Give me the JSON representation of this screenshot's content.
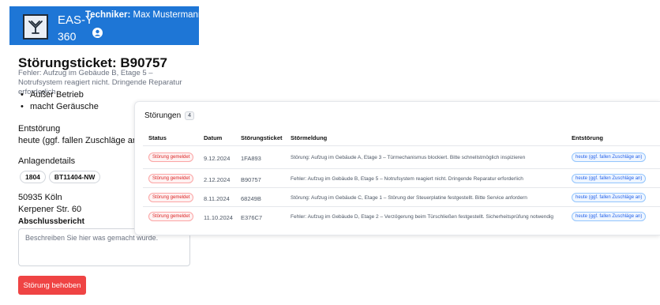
{
  "header": {
    "brand_line1": "EAS-Y",
    "brand_line2": "360",
    "technician_label": "Techniker:",
    "technician_name": "Max Mustermann",
    "logo_icon": "antenna-logo-icon",
    "user_icon": "user-circle-icon",
    "color": "#1e76d6"
  },
  "ticket": {
    "title": "Störungsticket: B90757",
    "description": "Fehler: Aufzug im Gebäude B, Etage 5 – Notrufsystem reagiert nicht. Dringende Reparatur erforderlich",
    "bullets": [
      "Außer Betrieb",
      "macht Geräusche"
    ],
    "entstoerung_label": "Entstörung",
    "entstoerung_value": "heute (ggf. fallen Zuschläge an)",
    "anlagendetails_label": "Anlagendetails",
    "chips": [
      "1804",
      "BT11404-NW"
    ],
    "city": "50935 Köln",
    "street": "Kerpener Str. 60",
    "abschluss_label": "Abschlussbericht",
    "textarea_placeholder": "Beschreiben Sie hier was gemacht wurde.",
    "fix_button": "Störung behoben",
    "fix_button_color": "#ef4444"
  },
  "stoerungen": {
    "title": "Störungen",
    "count": "4",
    "columns": [
      "Status",
      "Datum",
      "Störungsticket",
      "Störmeldung",
      "Entstörung"
    ],
    "rows": [
      {
        "status": "Störung gemeldet",
        "datum": "9.12.2024",
        "ticket": "1FA893",
        "meldung": "Störung: Aufzug im Gebäude A, Etage 3 – Türmechanismus blockiert. Bitte schnellstmöglich inspizieren",
        "entstoerung": "heute (ggf. fallen Zuschläge an)"
      },
      {
        "status": "Störung gemeldet",
        "datum": "2.12.2024",
        "ticket": "B90757",
        "meldung": "Fehler: Aufzug im Gebäude B, Etage 5 – Notrufsystem reagiert nicht. Dringende Reparatur erforderlich",
        "entstoerung": "heute (ggf. fallen Zuschläge an)"
      },
      {
        "status": "Störung gemeldet",
        "datum": "8.11.2024",
        "ticket": "68249B",
        "meldung": "Störung: Aufzug im Gebäude C, Etage 1 – Störung der Steuerplatine festgestellt. Bitte Service anfordern",
        "entstoerung": "heute (ggf. fallen Zuschläge an)"
      },
      {
        "status": "Störung gemeldet",
        "datum": "11.10.2024",
        "ticket": "E376C7",
        "meldung": "Fehler: Aufzug im Gebäude D, Etage 2 – Verzögerung beim Türschließen festgestellt. Sicherheitsprüfung notwendig",
        "entstoerung": "heute (ggf. fallen Zuschläge an)"
      }
    ],
    "status_color": "#dc2626",
    "entstoerung_color": "#2563eb"
  }
}
